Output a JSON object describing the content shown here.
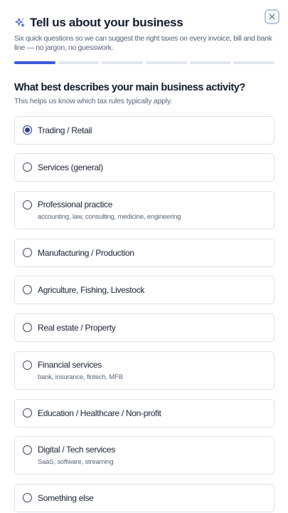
{
  "header": {
    "title": "Tell us about your business",
    "subtitle": "Six quick questions so we can suggest the right taxes on every invoice, bill and bank line — no jargon, no guesswork.",
    "icon": "sparkle-icon",
    "close_icon": "close-icon"
  },
  "progress": {
    "total_steps": 6,
    "current_step": 1,
    "accent_color": "#3a5bd9"
  },
  "question": {
    "title": "What best describes your main business activity?",
    "help": "This helps us know which tax rules typically apply."
  },
  "options": [
    {
      "label": "Trading / Retail",
      "description": "",
      "selected": true
    },
    {
      "label": "Services (general)",
      "description": "",
      "selected": false
    },
    {
      "label": "Professional practice",
      "description": "accounting, law, consulting, medicine, engineering",
      "selected": false
    },
    {
      "label": "Manufacturing / Production",
      "description": "",
      "selected": false
    },
    {
      "label": "Agriculture, Fishing, Livestock",
      "description": "",
      "selected": false
    },
    {
      "label": "Real estate / Property",
      "description": "",
      "selected": false
    },
    {
      "label": "Financial services",
      "description": "bank, insurance, fintech, MFB",
      "selected": false
    },
    {
      "label": "Education / Healthcare / Non-profit",
      "description": "",
      "selected": false
    },
    {
      "label": "Digital / Tech services",
      "description": "SaaS, software, streaming",
      "selected": false
    },
    {
      "label": "Something else",
      "description": "",
      "selected": false
    }
  ]
}
